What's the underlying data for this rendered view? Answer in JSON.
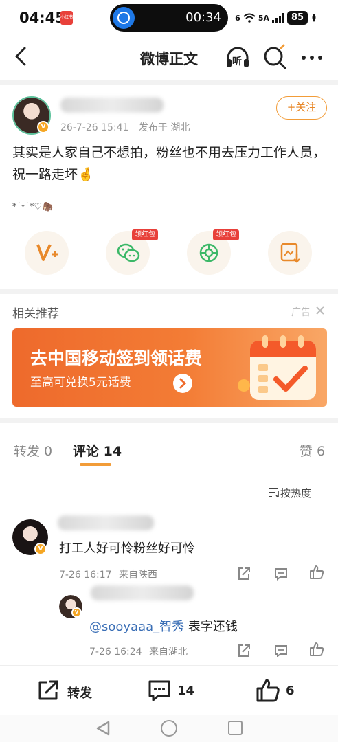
{
  "status_bar": {
    "time": "04:45",
    "app_badge": "小红书",
    "timer": "00:34",
    "network": "6",
    "signal": "5A",
    "battery": "85"
  },
  "nav": {
    "title": "微博正文",
    "listen_label": "听"
  },
  "post": {
    "time": "26-7-26 15:41",
    "location": "发布于 湖北",
    "follow_label": "+关注",
    "text": "其实是人家自己不想拍，粉丝也不用去压力工作人员，祝一路走坏🤞",
    "emoji_line": "*˙ᵕ˙*♡🦣",
    "share_badges": [
      "领红包",
      "领红包"
    ],
    "avatar_badge": "V"
  },
  "recommend": {
    "title": "相关推荐",
    "ad_label": "广告",
    "banner_main": "去中国移动签到领话费",
    "banner_sub": "至高可兑换5元话费"
  },
  "tabs": {
    "repost": "转发 0",
    "comment": "评论 14",
    "like": "赞 6"
  },
  "sort_label": "按热度",
  "comments": [
    {
      "text": "打工人好可怜粉丝好可怜",
      "time": "7-26 16:17",
      "from": "来自陕西"
    }
  ],
  "reply": {
    "mention": "@sooyaaa_智秀",
    "text": " 表字还钱",
    "time": "7-26 16:24",
    "from": "来自湖北"
  },
  "bottom_bar": {
    "repost_label": "转发",
    "comment_count": "14",
    "like_count": "6"
  },
  "colors": {
    "accent": "#f29c38",
    "banner": "#ef6b2c",
    "redpack": "#e8403a",
    "link": "#3b6fb6"
  }
}
